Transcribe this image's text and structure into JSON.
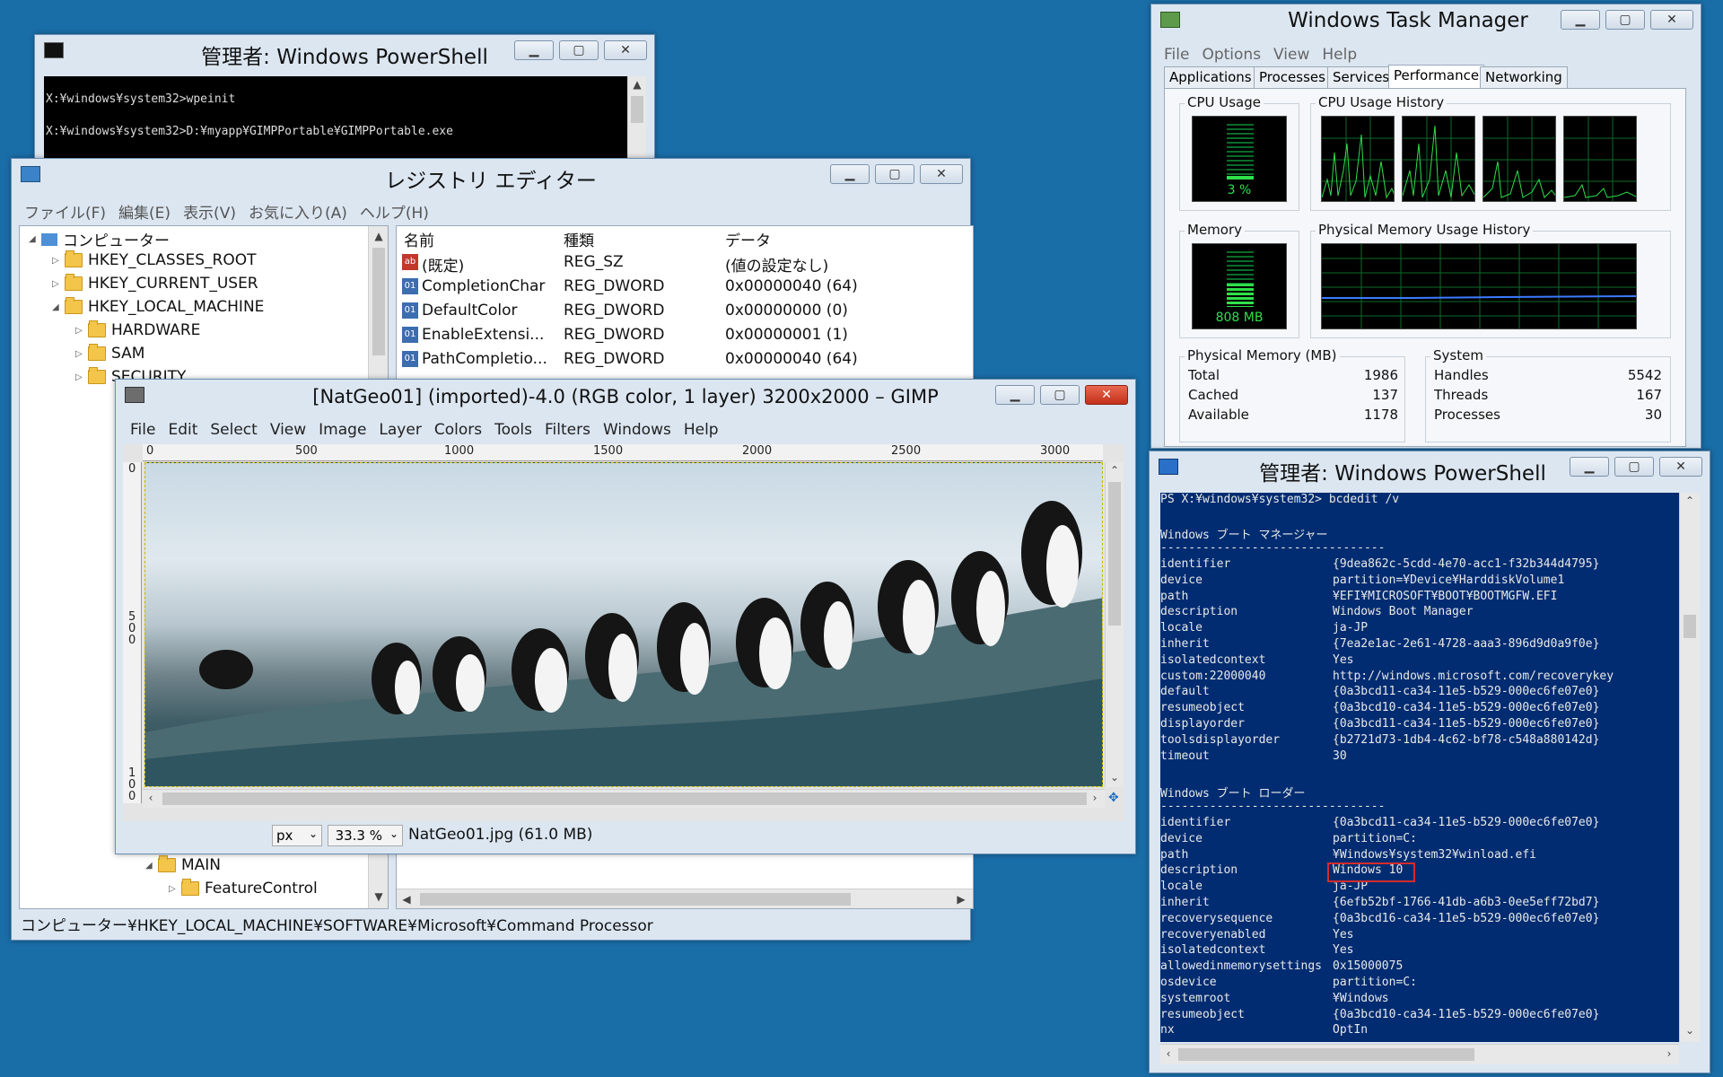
{
  "ps_small": {
    "title": "管理者: Windows PowerShell",
    "lines": [
      "X:¥windows¥system32>wpeinit",
      "X:¥windows¥system32>D:¥myapp¥GIMPPortable¥GIMPPortable.exe"
    ]
  },
  "registry": {
    "title": "レジストリ エディター",
    "menu": [
      "ファイル(F)",
      "編集(E)",
      "表示(V)",
      "お気に入り(A)",
      "ヘルプ(H)"
    ],
    "tree": {
      "root": "コンピューター",
      "hkcr": "HKEY_CLASSES_ROOT",
      "hkcu": "HKEY_CURRENT_USER",
      "hklm": "HKEY_LOCAL_MACHINE",
      "hardware": "HARDWARE",
      "sam": "SAM",
      "security": "SECURITY",
      "main": "MAIN",
      "feature_control": "FeatureControl"
    },
    "columns": [
      "名前",
      "種類",
      "データ"
    ],
    "values": [
      {
        "icon": "ab",
        "name": "(既定)",
        "type": "REG_SZ",
        "data": "(値の設定なし)"
      },
      {
        "icon": "bin",
        "name": "CompletionChar",
        "type": "REG_DWORD",
        "data": "0x00000040 (64)"
      },
      {
        "icon": "bin",
        "name": "DefaultColor",
        "type": "REG_DWORD",
        "data": "0x00000000 (0)"
      },
      {
        "icon": "bin",
        "name": "EnableExtensi...",
        "type": "REG_DWORD",
        "data": "0x00000001 (1)"
      },
      {
        "icon": "bin",
        "name": "PathCompletio...",
        "type": "REG_DWORD",
        "data": "0x00000040 (64)"
      }
    ],
    "status": "コンピューター¥HKEY_LOCAL_MACHINE¥SOFTWARE¥Microsoft¥Command Processor"
  },
  "gimp": {
    "title": "[NatGeo01] (imported)-4.0 (RGB color, 1 layer) 3200x2000 – GIMP",
    "menu": [
      "File",
      "Edit",
      "Select",
      "View",
      "Image",
      "Layer",
      "Colors",
      "Tools",
      "Filters",
      "Windows",
      "Help"
    ],
    "hruler": [
      "0",
      "500",
      "1000",
      "1500",
      "2000",
      "2500",
      "3000"
    ],
    "vruler": [
      "0",
      "5\n0\n0",
      "1\n0\n0"
    ],
    "unit": "px",
    "zoom": "33.3 %",
    "file_info": "NatGeo01.jpg (61.0 MB)"
  },
  "taskmgr": {
    "title": "Windows Task Manager",
    "menu": [
      "File",
      "Options",
      "View",
      "Help"
    ],
    "tabs": [
      "Applications",
      "Processes",
      "Services",
      "Performance",
      "Networking"
    ],
    "active_tab": "Performance",
    "cpu_label": "CPU Usage",
    "cpu_value": "3 %",
    "cpu_history_label": "CPU Usage History",
    "memory_label": "Memory",
    "memory_value": "808 MB",
    "mem_history_label": "Physical Memory Usage History",
    "phys_mem": {
      "label": "Physical Memory (MB)",
      "rows": [
        {
          "k": "Total",
          "v": "1986"
        },
        {
          "k": "Cached",
          "v": "137"
        },
        {
          "k": "Available",
          "v": "1178"
        }
      ]
    },
    "system": {
      "label": "System",
      "rows": [
        {
          "k": "Handles",
          "v": "5542"
        },
        {
          "k": "Threads",
          "v": "167"
        },
        {
          "k": "Processes",
          "v": "30"
        }
      ]
    },
    "colors": {
      "graph_green": "#2ee04a",
      "graph_grid": "#0b6b2a",
      "mem_line": "#3b7bff"
    }
  },
  "ps_big": {
    "title": "管理者: Windows PowerShell",
    "prompt": "PS X:¥windows¥system32> bcdedit /v",
    "section1": "Windows ブート マネージャー",
    "section2": "Windows ブート ローダー",
    "separator": "--------------------------------",
    "bootmgr": [
      {
        "k": "identifier",
        "v": "{9dea862c-5cdd-4e70-acc1-f32b344d4795}"
      },
      {
        "k": "device",
        "v": "partition=¥Device¥HarddiskVolume1"
      },
      {
        "k": "path",
        "v": "¥EFI¥MICROSOFT¥BOOT¥BOOTMGFW.EFI"
      },
      {
        "k": "description",
        "v": "Windows Boot Manager"
      },
      {
        "k": "locale",
        "v": "ja-JP"
      },
      {
        "k": "inherit",
        "v": "{7ea2e1ac-2e61-4728-aaa3-896d9d0a9f0e}"
      },
      {
        "k": "isolatedcontext",
        "v": "Yes"
      },
      {
        "k": "custom:22000040",
        "v": "http://windows.microsoft.com/recoverykey"
      },
      {
        "k": "default",
        "v": "{0a3bcd11-ca34-11e5-b529-000ec6fe07e0}"
      },
      {
        "k": "resumeobject",
        "v": "{0a3bcd10-ca34-11e5-b529-000ec6fe07e0}"
      },
      {
        "k": "displayorder",
        "v": "{0a3bcd11-ca34-11e5-b529-000ec6fe07e0}"
      },
      {
        "k": "toolsdisplayorder",
        "v": "{b2721d73-1db4-4c62-bf78-c548a880142d}"
      },
      {
        "k": "timeout",
        "v": "30"
      }
    ],
    "loader": [
      {
        "k": "identifier",
        "v": "{0a3bcd11-ca34-11e5-b529-000ec6fe07e0}"
      },
      {
        "k": "device",
        "v": "partition=C:"
      },
      {
        "k": "path",
        "v": "¥Windows¥system32¥winload.efi"
      },
      {
        "k": "description",
        "v": "Windows 10"
      },
      {
        "k": "locale",
        "v": "ja-JP"
      },
      {
        "k": "inherit",
        "v": "{6efb52bf-1766-41db-a6b3-0ee5eff72bd7}"
      },
      {
        "k": "recoverysequence",
        "v": "{0a3bcd16-ca34-11e5-b529-000ec6fe07e0}"
      },
      {
        "k": "recoveryenabled",
        "v": "Yes"
      },
      {
        "k": "isolatedcontext",
        "v": "Yes"
      },
      {
        "k": "allowedinmemorysettings",
        "v": "0x15000075"
      },
      {
        "k": "osdevice",
        "v": "partition=C:"
      },
      {
        "k": "systemroot",
        "v": "¥Windows"
      },
      {
        "k": "resumeobject",
        "v": "{0a3bcd10-ca34-11e5-b529-000ec6fe07e0}"
      },
      {
        "k": "nx",
        "v": "OptIn"
      }
    ]
  }
}
